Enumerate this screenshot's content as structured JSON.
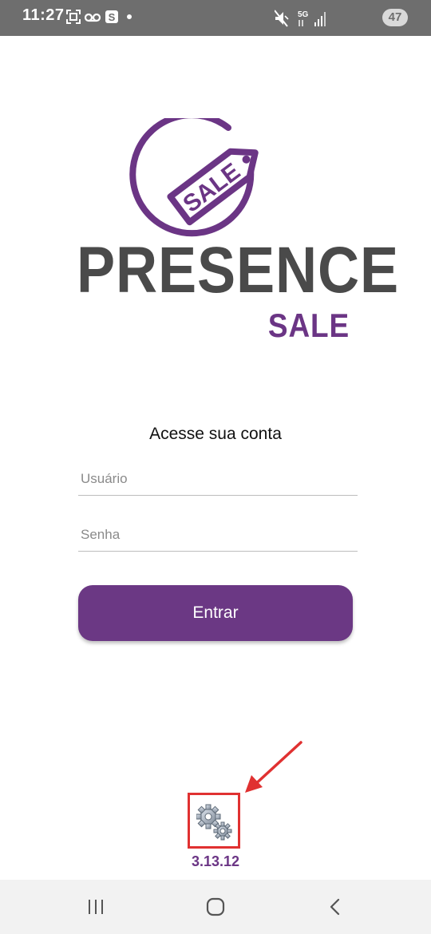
{
  "status_bar": {
    "time": "11:27",
    "battery_level": "47",
    "network_label": "5G",
    "icons": [
      "screenshot-icon",
      "voicemail-icon",
      "s-app-icon",
      "notification-dot-icon",
      "mute-icon",
      "5g-icon",
      "signal-icon",
      "battery-icon"
    ]
  },
  "logo": {
    "tag_text": "SALE",
    "wordmark": "PRESENCE",
    "subtitle": "SALE"
  },
  "login": {
    "title": "Acesse sua conta",
    "username_placeholder": "Usuário",
    "password_placeholder": "Senha",
    "submit_label": "Entrar"
  },
  "footer": {
    "settings_icon": "gears-icon",
    "version": "3.13.12"
  },
  "colors": {
    "brand_purple": "#6b3884",
    "status_bar": "#6e6e6e",
    "annotation_red": "#e03131"
  },
  "nav_bar": {
    "icons": [
      "recent-apps-icon",
      "home-icon",
      "back-icon"
    ]
  }
}
